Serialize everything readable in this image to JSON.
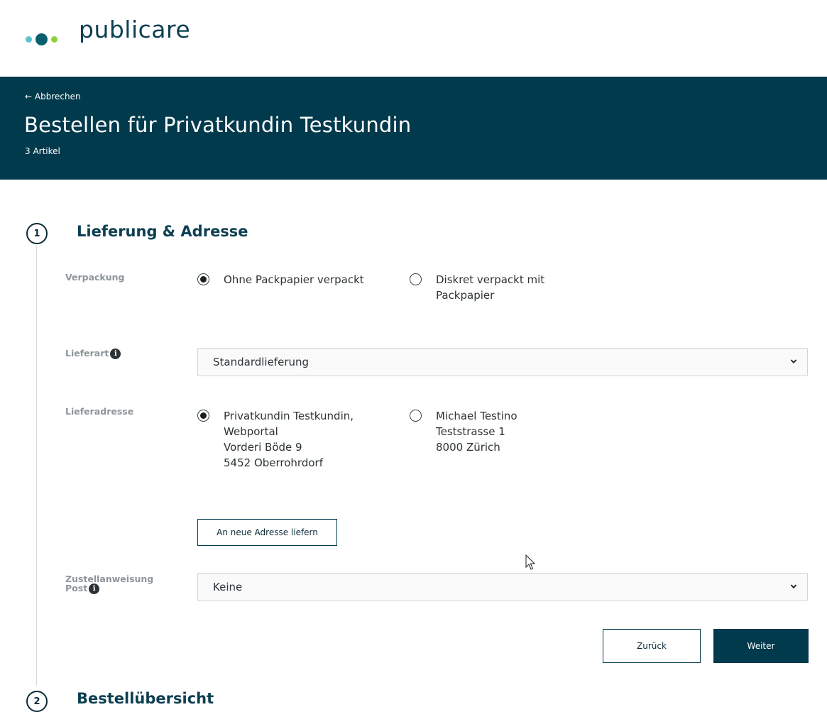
{
  "brand": {
    "name": "publicare"
  },
  "header": {
    "back_link": "← Abbrechen",
    "title": "Bestellen für Privatkundin Testkundin",
    "subtitle": "3 Artikel"
  },
  "steps": [
    {
      "number": "1",
      "title": "Lieferung & Adresse"
    },
    {
      "number": "2",
      "title": "Bestellübersicht"
    }
  ],
  "form": {
    "packaging": {
      "label": "Verpackung",
      "options": [
        {
          "lines": [
            "Ohne Packpapier verpackt"
          ],
          "selected": true
        },
        {
          "lines": [
            "Diskret verpackt mit",
            "Packpapier"
          ],
          "selected": false
        }
      ]
    },
    "delivery_type": {
      "label": "Lieferart",
      "value": "Standardlieferung"
    },
    "delivery_address": {
      "label": "Lieferadresse",
      "options": [
        {
          "lines": [
            "Privatkundin Testkundin,",
            "Webportal",
            "Vorderi Böde 9",
            "5452 Oberrohrdorf"
          ],
          "selected": true
        },
        {
          "lines": [
            "Michael Testino",
            "Teststrasse 1",
            "8000 Zürich"
          ],
          "selected": false
        }
      ]
    },
    "new_address_button": "An neue Adresse liefern",
    "delivery_instruction": {
      "label_lines": [
        "Zustellanweisung",
        "Post"
      ],
      "value": "Keine"
    }
  },
  "actions": {
    "back": "Zurück",
    "next": "Weiter"
  },
  "colors": {
    "brand_dark": "#013a4c",
    "dot_light": "#5ec3cf",
    "dot_teal": "#0a5f6e",
    "dot_green": "#8ccf3f"
  }
}
